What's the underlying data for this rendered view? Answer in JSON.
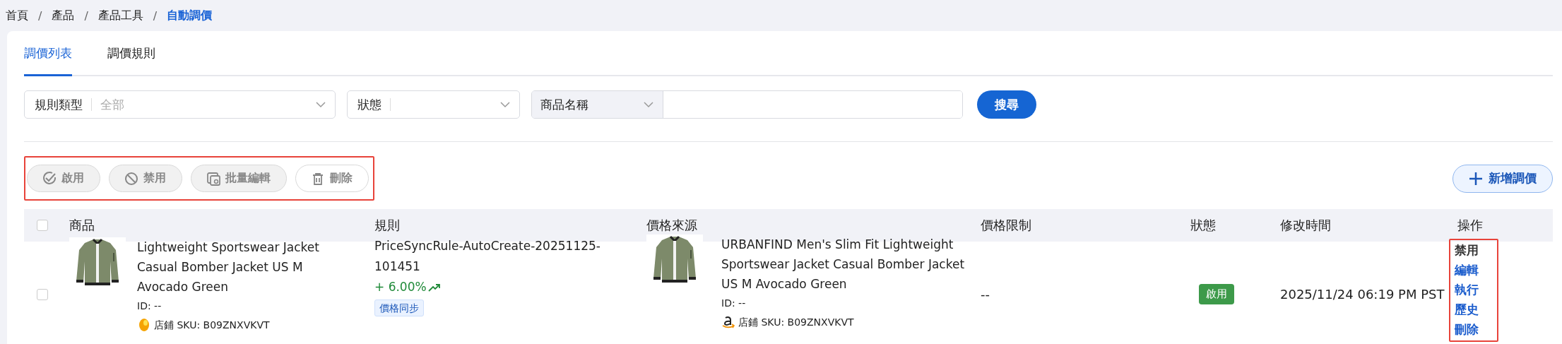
{
  "breadcrumb": [
    {
      "label": "首頁",
      "current": false,
      "separator": "/"
    },
    {
      "label": "產品",
      "current": false,
      "separator": "/"
    },
    {
      "label": "產品工具",
      "current": false,
      "separator": "/"
    },
    {
      "label": "自動調價",
      "current": true
    }
  ],
  "tabs": [
    {
      "label": "調價列表",
      "selected": true
    },
    {
      "label": "調價規則",
      "selected": false
    }
  ],
  "filters": [
    {
      "kind": "select",
      "label": "規則類型",
      "value": "全部"
    },
    {
      "kind": "select",
      "label": "狀態"
    },
    {
      "kind": "combo",
      "option": "商品名稱"
    }
  ],
  "search_button": "搜尋",
  "bulk_actions": [
    {
      "kind": "enable",
      "label": "啟用",
      "disabled": true
    },
    {
      "kind": "disable",
      "label": "禁用",
      "disabled": true
    },
    {
      "kind": "batch-edit",
      "label": "批量編輯",
      "disabled": true
    },
    {
      "kind": "delete",
      "label": "刪除",
      "disabled": true
    }
  ],
  "add_button": "新增調價",
  "table": {
    "select_all_checked": false,
    "columns": [
      "商品",
      "規則",
      "價格來源",
      "價格限制",
      "狀態",
      "修改時間",
      "操作"
    ],
    "rows": [
      {
        "checked": false,
        "product": {
          "title": "Lightweight Sportswear Jacket Casual Bomber Jacket US M Avocado Green",
          "id": "ID: --",
          "store": {
            "kind": "egg",
            "sku": "店鋪 SKU: B09ZNXVKVT"
          }
        },
        "rule": {
          "name": "PriceSyncRule-AutoCreate-20251125-101451",
          "change": {
            "kind": "up",
            "text": "+ 6.00%"
          },
          "tag": "價格同步"
        },
        "source": {
          "title": "URBANFIND Men's Slim Fit Lightweight Sportswear Jacket Casual Bomber Jacket US M Avocado Green",
          "id": "ID: --",
          "store": {
            "kind": "smile",
            "sku": "店鋪 SKU: B09ZNXVKVT"
          }
        },
        "limit": "--",
        "status": {
          "kind": "enabled",
          "label": "啟用"
        },
        "modified": "2025/11/24 06:19 PM PST",
        "actions": [
          {
            "kind": "toggle",
            "label": "禁用"
          },
          {
            "kind": "link",
            "label": "編輯"
          },
          {
            "kind": "link",
            "label": "執行"
          },
          {
            "kind": "link",
            "label": "歷史"
          },
          {
            "kind": "link",
            "label": "刪除"
          }
        ]
      }
    ]
  }
}
